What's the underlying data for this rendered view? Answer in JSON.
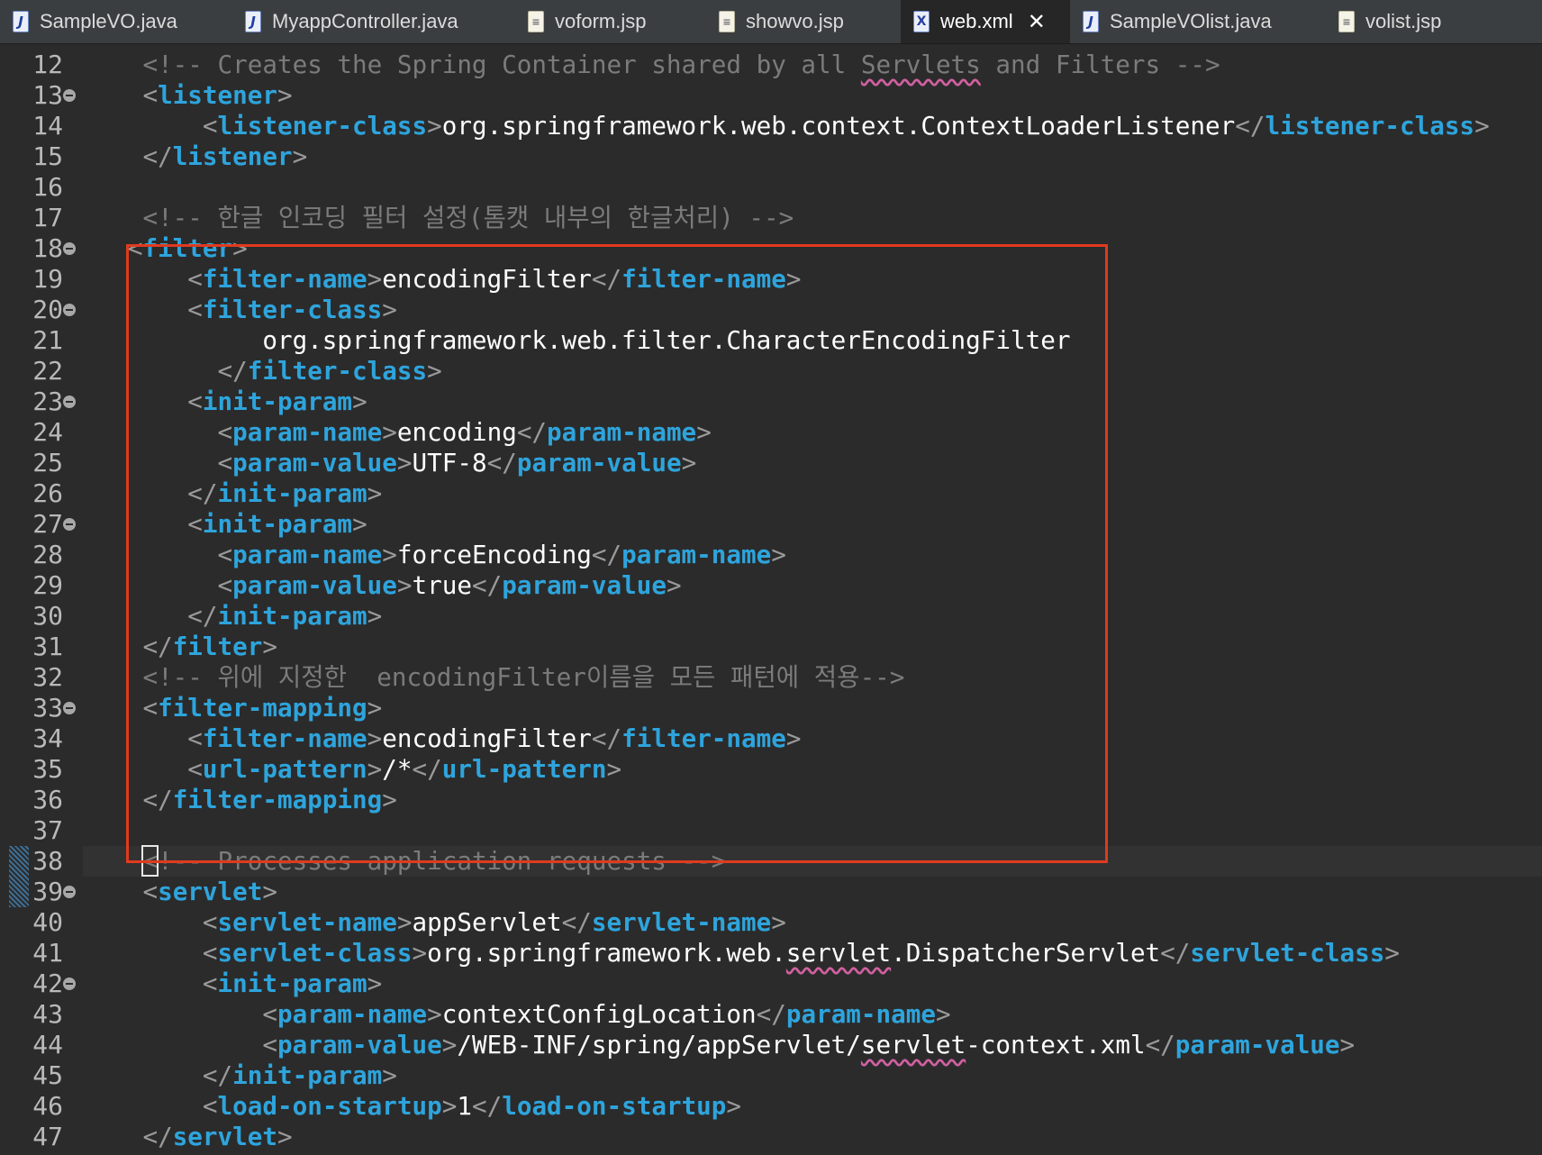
{
  "tabs": [
    {
      "label": "SampleVO.java",
      "icon": "java-file-icon",
      "active": false
    },
    {
      "label": "MyappController.java",
      "icon": "java-file-icon",
      "active": false
    },
    {
      "label": "voform.jsp",
      "icon": "jsp-file-icon",
      "active": false
    },
    {
      "label": "showvo.jsp",
      "icon": "jsp-file-icon",
      "active": false
    },
    {
      "label": "web.xml",
      "icon": "xml-file-icon",
      "active": true
    },
    {
      "label": "SampleVOlist.java",
      "icon": "java-file-icon",
      "active": false
    },
    {
      "label": "volist.jsp",
      "icon": "jsp-file-icon",
      "active": false
    }
  ],
  "editor": {
    "lines": [
      {
        "n": "12",
        "text": "    <!-- Creates the Spring Container shared by all Servlets and Filters -->"
      },
      {
        "n": "13",
        "text": "    <listener>",
        "fold": true
      },
      {
        "n": "14",
        "text": "        <listener-class>org.springframework.web.context.ContextLoaderListener</listener-class>"
      },
      {
        "n": "15",
        "text": "    </listener>"
      },
      {
        "n": "16",
        "text": ""
      },
      {
        "n": "17",
        "text": "    <!-- 한글 인코딩 필터 설정(톰캣 내부의 한글처리) -->"
      },
      {
        "n": "18",
        "text": "   <filter>",
        "fold": true
      },
      {
        "n": "19",
        "text": "       <filter-name>encodingFilter</filter-name>"
      },
      {
        "n": "20",
        "text": "       <filter-class>",
        "fold": true
      },
      {
        "n": "21",
        "text": "            org.springframework.web.filter.CharacterEncodingFilter"
      },
      {
        "n": "22",
        "text": "         </filter-class>"
      },
      {
        "n": "23",
        "text": "       <init-param>",
        "fold": true
      },
      {
        "n": "24",
        "text": "         <param-name>encoding</param-name>"
      },
      {
        "n": "25",
        "text": "         <param-value>UTF-8</param-value>"
      },
      {
        "n": "26",
        "text": "       </init-param>"
      },
      {
        "n": "27",
        "text": "       <init-param>",
        "fold": true
      },
      {
        "n": "28",
        "text": "         <param-name>forceEncoding</param-name>"
      },
      {
        "n": "29",
        "text": "         <param-value>true</param-value>"
      },
      {
        "n": "30",
        "text": "       </init-param>"
      },
      {
        "n": "31",
        "text": "    </filter>"
      },
      {
        "n": "32",
        "text": "    <!-- 위에 지정한  encodingFilter이름을 모든 패턴에 적용-->"
      },
      {
        "n": "33",
        "text": "    <filter-mapping>",
        "fold": true
      },
      {
        "n": "34",
        "text": "       <filter-name>encodingFilter</filter-name>"
      },
      {
        "n": "35",
        "text": "       <url-pattern>/*</url-pattern>"
      },
      {
        "n": "36",
        "text": "    </filter-mapping>"
      },
      {
        "n": "37",
        "text": ""
      },
      {
        "n": "38",
        "text": "    <!-- Processes application requests -->",
        "current": true,
        "change": true
      },
      {
        "n": "39",
        "text": "    <servlet>",
        "fold": true,
        "change": true
      },
      {
        "n": "40",
        "text": "        <servlet-name>appServlet</servlet-name>"
      },
      {
        "n": "41",
        "text": "        <servlet-class>org.springframework.web.servlet.DispatcherServlet</servlet-class>"
      },
      {
        "n": "42",
        "text": "        <init-param>",
        "fold": true
      },
      {
        "n": "43",
        "text": "            <param-name>contextConfigLocation</param-name>"
      },
      {
        "n": "44",
        "text": "            <param-value>/WEB-INF/spring/appServlet/servlet-context.xml</param-value>"
      },
      {
        "n": "45",
        "text": "        </init-param>"
      },
      {
        "n": "46",
        "text": "        <load-on-startup>1</load-on-startup>"
      },
      {
        "n": "47",
        "text": "    </servlet>"
      }
    ],
    "spelling_flagged": [
      "Servlets",
      "servlet"
    ],
    "colors": {
      "background": "#2b2b2b",
      "tag": "#2ea4dc",
      "bracket": "#9a9a9a",
      "comment": "#7b7b7b",
      "text": "#ffffff",
      "highlight_box": "#e03a1e"
    }
  }
}
